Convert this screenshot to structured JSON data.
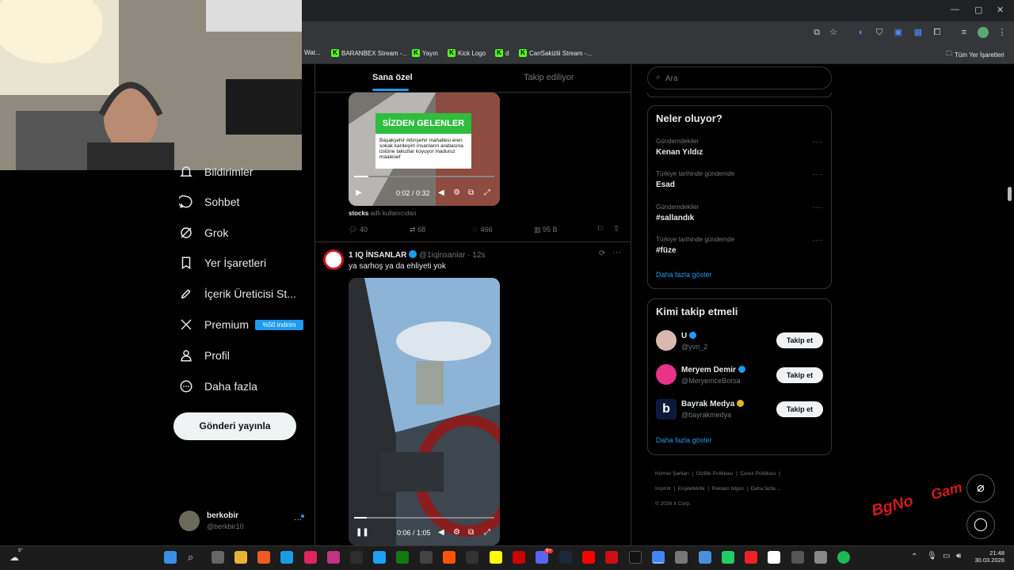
{
  "browser": {
    "bookmarks": [
      {
        "label": "Wat...",
        "kick": false
      },
      {
        "label": "BARANBEX Stream -...",
        "kick": true
      },
      {
        "label": "Yayın",
        "kick": true
      },
      {
        "label": "Kick Logo",
        "kick": true
      },
      {
        "label": "d",
        "kick": true
      },
      {
        "label": "CanSakizlii Stream -...",
        "kick": true
      }
    ],
    "all_bookmarks": "Tüm Yer İşaretleri"
  },
  "nav": {
    "notifications": "Bildirimler",
    "chat": "Sohbet",
    "grok": "Grok",
    "bookmarks": "Yer İşaretleri",
    "creator": "İçerik Üreticisi St...",
    "premium": "Premium",
    "premium_badge": "%50 indirim",
    "profile": "Profil",
    "more": "Daha fazla",
    "post_button": "Gönderi yayınla"
  },
  "account": {
    "name": "berkobir",
    "handle": "@berkbir10"
  },
  "feed": {
    "tabs": [
      "Sana özel",
      "Takip ediliyor"
    ],
    "post1": {
      "banner": "SİZDEN GELENLER",
      "caption": "Başakşehir Altınşehir mahallesi eren sokak kardeşim  insanların arabasına üstüne takozlar koyuyor maduruz maalesef",
      "time": "0:02 / 0:32",
      "source_user": "stocks",
      "source_suffix": "adlı kullanıcıdan",
      "replies": "40",
      "reposts": "68",
      "likes": "466",
      "views": "95 B"
    },
    "post2": {
      "name": "1 IQ İNSANLAR",
      "handle": "@1iqinsanlar",
      "age": "· 12s",
      "text": "ya sarhoş ya da ehliyeti yok",
      "time": "0:06 / 1:05"
    }
  },
  "right": {
    "search_placeholder": "Ara",
    "trends_title": "Neler oluyor?",
    "trends": [
      {
        "context": "Gündemdekiler",
        "topic": "Kenan Yıldız"
      },
      {
        "context": "Türkiye tarihinde gündemde",
        "topic": "Esad"
      },
      {
        "context": "Gündemdekiler",
        "topic": "#sallandık"
      },
      {
        "context": "Türkiye tarihinde gündemde",
        "topic": "#füze"
      }
    ],
    "show_more": "Daha fazla göster",
    "who_title": "Kimi takip etmeli",
    "who": [
      {
        "name": "U",
        "handle": "@yvri_2",
        "badge_color": "#1d9bf0"
      },
      {
        "name": "Meryem Demir",
        "handle": "@MeryemceBorsa",
        "badge_color": "#1d9bf0"
      },
      {
        "name": "Bayrak Medya",
        "handle": "@bayrakmedya",
        "badge_color": "#e2b719"
      }
    ],
    "follow_label": "Takip et",
    "footer": [
      "Hizmet Şartları",
      "Gizlilik Politikası",
      "Çerez Politikası",
      "Imprint",
      "Erişilebilirlik",
      "Reklam bilgisi",
      "Daha fazla ...",
      "© 2026 X Corp."
    ]
  },
  "overlay": {
    "logo_text": "BgNo",
    "logo_text2": "Gam"
  },
  "taskbar": {
    "weather": "9°",
    "time": "21:48",
    "date": "30.03.2026",
    "discord_badge": "9+"
  }
}
